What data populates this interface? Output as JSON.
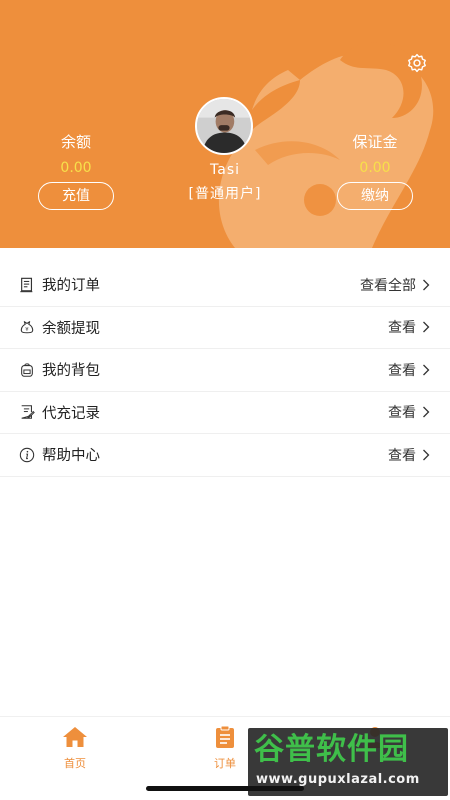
{
  "header": {
    "balance": {
      "label": "余额",
      "value": "0.00",
      "button": "充值"
    },
    "deposit": {
      "label": "保证金",
      "value": "0.00",
      "button": "缴纳"
    },
    "user": {
      "name": "Tasi",
      "type": "[普通用户]"
    },
    "accent_color": "#ee8f3c",
    "value_color": "#f7e04a"
  },
  "menu": {
    "items": [
      {
        "label": "我的订单",
        "action": "查看全部",
        "icon": "document-icon"
      },
      {
        "label": "余额提现",
        "action": "查看",
        "icon": "money-bag-icon"
      },
      {
        "label": "我的背包",
        "action": "查看",
        "icon": "backpack-icon"
      },
      {
        "label": "代充记录",
        "action": "查看",
        "icon": "record-icon"
      },
      {
        "label": "帮助中心",
        "action": "查看",
        "icon": "info-icon"
      }
    ]
  },
  "tabbar": {
    "tabs": [
      {
        "label": "首页",
        "icon": "home-icon"
      },
      {
        "label": "订单",
        "icon": "clipboard-icon"
      },
      {
        "label": "",
        "icon": "person-icon"
      }
    ]
  },
  "watermark": {
    "top": "谷普软件园",
    "bottom": "www.gupuxlazal.com"
  }
}
